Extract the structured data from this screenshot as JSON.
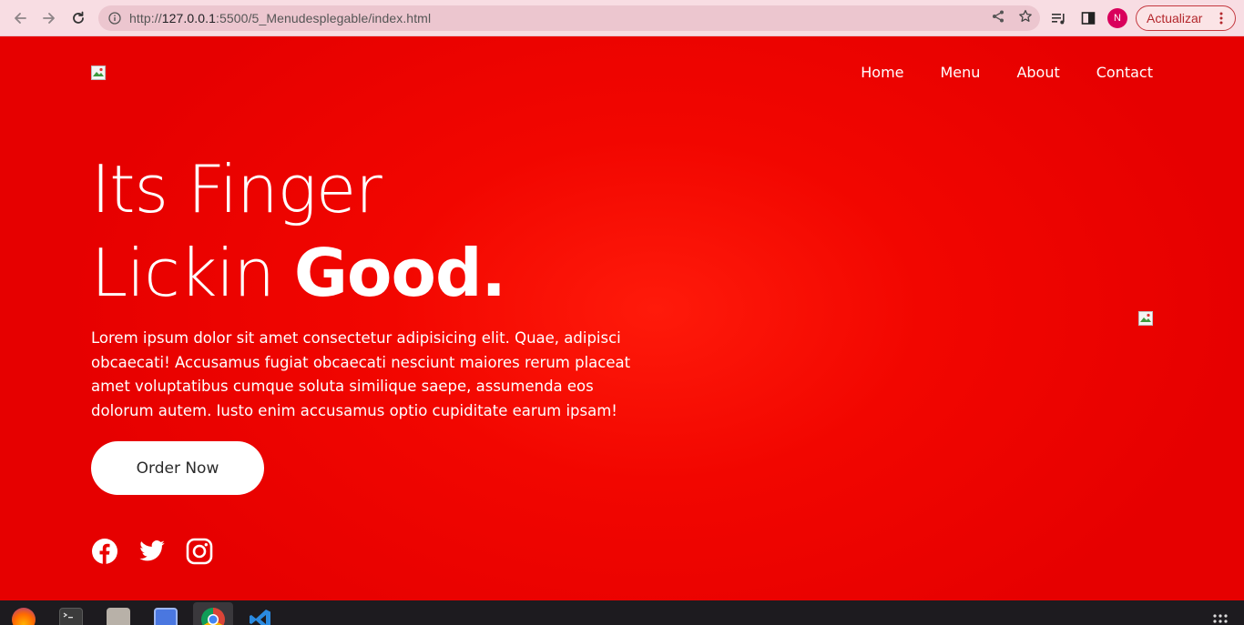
{
  "browser": {
    "url_prefix": "http://",
    "url_host": "127.0.0.1",
    "url_rest": ":5500/5_Menudesplegable/index.html",
    "avatar_letter": "N",
    "update_label": "Actualizar",
    "icons": [
      "back-icon",
      "forward-icon",
      "reload-icon",
      "info-icon",
      "share-icon",
      "star-icon",
      "reading-list-icon",
      "side-panel-icon",
      "more-icon"
    ]
  },
  "page": {
    "nav": [
      {
        "label": "Home"
      },
      {
        "label": "Menu"
      },
      {
        "label": "About"
      },
      {
        "label": "Contact"
      }
    ],
    "headline": {
      "line1": "Its Finger",
      "line2_light": "Lickin ",
      "line2_bold": "Good."
    },
    "description": "Lorem ipsum dolor sit amet consectetur adipisicing elit. Quae, adipisci obcaecati! Accusamus fugiat obcaecati nesciunt maiores rerum placeat amet voluptatibus cumque soluta similique saepe, assumenda eos dolorum autem. Iusto enim accusamus optio cupiditate earum ipsam!",
    "cta_label": "Order Now",
    "social_icons": [
      "facebook-icon",
      "twitter-icon",
      "instagram-icon"
    ],
    "colors": {
      "background": "#e60000",
      "background_center": "#ff1a0a",
      "button_bg": "#ffffff",
      "button_text": "#2b2b2b"
    }
  },
  "taskbar": {
    "apps": [
      "firefox-icon",
      "terminal-icon",
      "files-icon",
      "screenshot-icon",
      "chrome-icon",
      "vscode-icon",
      "app-grid-icon"
    ],
    "active_app": "chrome-icon"
  }
}
